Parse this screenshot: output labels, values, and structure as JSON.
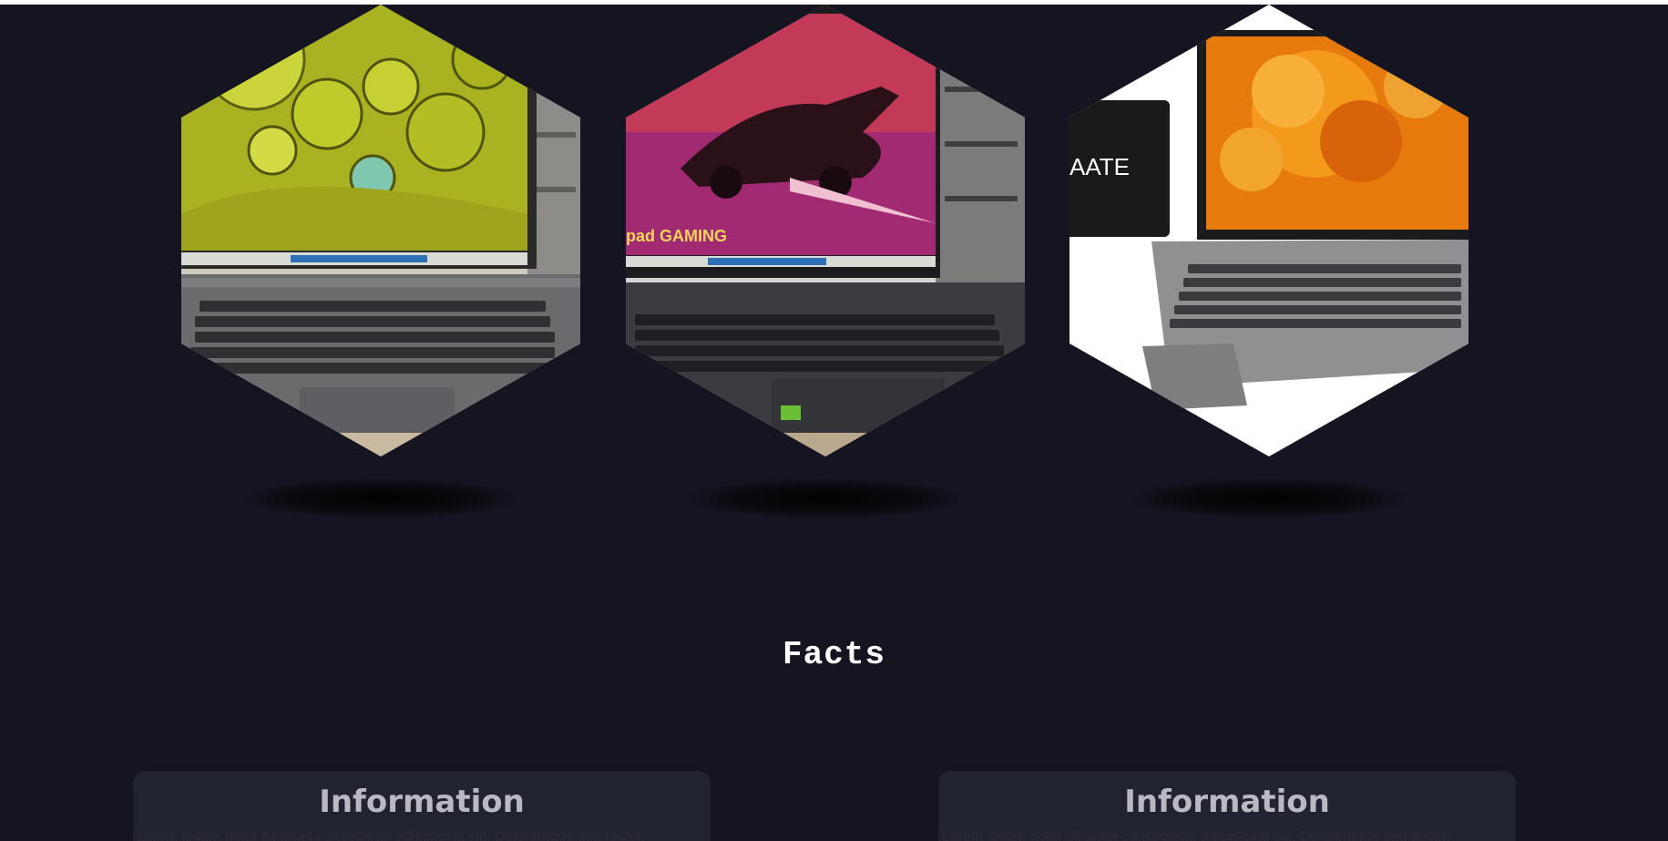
{
  "gallery": {
    "items": [
      {
        "name": "Laptop with yellow abstract wallpaper"
      },
      {
        "name": "IdeaPad Gaming laptop"
      },
      {
        "name": "Laptop with orange flower wallpaper"
      }
    ],
    "image_texts": {
      "gaming_logo": "pad GAMING",
      "box_label": "AATE"
    }
  },
  "facts": {
    "title": "Facts",
    "cards": [
      {
        "title": "Information",
        "text": "Lorem ipsum dolor sit amet consectetur adipisicing elit. Doloremque sed ipsam"
      },
      {
        "title": "Information",
        "text": "Lorem ipsum dolor sit amet consectetur adipisicing elit. Doloremque sed ipsam"
      }
    ]
  },
  "colors": {
    "background": "#141520",
    "card": "#222330",
    "heading": "#ffffff",
    "card_title": "#b8b9c2"
  }
}
